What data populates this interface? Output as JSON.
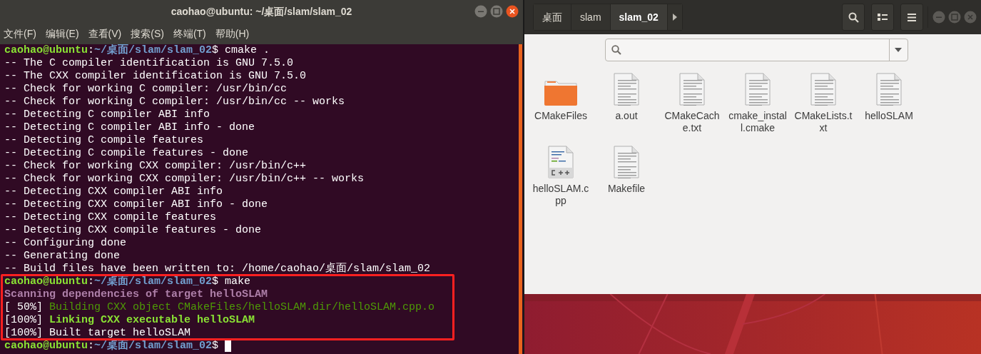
{
  "terminal": {
    "title": "caohao@ubuntu: ~/桌面/slam/slam_02",
    "menu": [
      "文件(F)",
      "编辑(E)",
      "查看(V)",
      "搜索(S)",
      "终端(T)",
      "帮助(H)"
    ],
    "lines": [
      {
        "segments": [
          {
            "text": "caohao@ubuntu",
            "kind": "user"
          },
          {
            "text": ":",
            "kind": "plain"
          },
          {
            "text": "~/桌面/slam/slam_02",
            "kind": "path"
          },
          {
            "text": "$ cmake .",
            "kind": "plain"
          }
        ]
      },
      {
        "segments": [
          {
            "text": "-- The C compiler identification is GNU 7.5.0",
            "kind": "plain"
          }
        ]
      },
      {
        "segments": [
          {
            "text": "-- The CXX compiler identification is GNU 7.5.0",
            "kind": "plain"
          }
        ]
      },
      {
        "segments": [
          {
            "text": "-- Check for working C compiler: /usr/bin/cc",
            "kind": "plain"
          }
        ]
      },
      {
        "segments": [
          {
            "text": "-- Check for working C compiler: /usr/bin/cc -- works",
            "kind": "plain"
          }
        ]
      },
      {
        "segments": [
          {
            "text": "-- Detecting C compiler ABI info",
            "kind": "plain"
          }
        ]
      },
      {
        "segments": [
          {
            "text": "-- Detecting C compiler ABI info - done",
            "kind": "plain"
          }
        ]
      },
      {
        "segments": [
          {
            "text": "-- Detecting C compile features",
            "kind": "plain"
          }
        ]
      },
      {
        "segments": [
          {
            "text": "-- Detecting C compile features - done",
            "kind": "plain"
          }
        ]
      },
      {
        "segments": [
          {
            "text": "-- Check for working CXX compiler: /usr/bin/c++",
            "kind": "plain"
          }
        ]
      },
      {
        "segments": [
          {
            "text": "-- Check for working CXX compiler: /usr/bin/c++ -- works",
            "kind": "plain"
          }
        ]
      },
      {
        "segments": [
          {
            "text": "-- Detecting CXX compiler ABI info",
            "kind": "plain"
          }
        ]
      },
      {
        "segments": [
          {
            "text": "-- Detecting CXX compiler ABI info - done",
            "kind": "plain"
          }
        ]
      },
      {
        "segments": [
          {
            "text": "-- Detecting CXX compile features",
            "kind": "plain"
          }
        ]
      },
      {
        "segments": [
          {
            "text": "-- Detecting CXX compile features - done",
            "kind": "plain"
          }
        ]
      },
      {
        "segments": [
          {
            "text": "-- Configuring done",
            "kind": "plain"
          }
        ]
      },
      {
        "segments": [
          {
            "text": "-- Generating done",
            "kind": "plain"
          }
        ]
      },
      {
        "segments": [
          {
            "text": "-- Build files have been written to: /home/caohao/桌面/slam/slam_02",
            "kind": "plain"
          }
        ]
      },
      {
        "segments": [
          {
            "text": "caohao@ubuntu",
            "kind": "user"
          },
          {
            "text": ":",
            "kind": "plain"
          },
          {
            "text": "~/桌面/slam/slam_02",
            "kind": "path"
          },
          {
            "text": "$ make",
            "kind": "plain"
          }
        ]
      },
      {
        "segments": [
          {
            "text": "Scanning dependencies of target helloSLAM",
            "kind": "scan"
          }
        ]
      },
      {
        "segments": [
          {
            "text": "[ 50%] ",
            "kind": "plain"
          },
          {
            "text": "Building CXX object CMakeFiles/helloSLAM.dir/helloSLAM.cpp.o",
            "kind": "build"
          }
        ]
      },
      {
        "segments": [
          {
            "text": "[100%] ",
            "kind": "plain"
          },
          {
            "text": "Linking CXX executable helloSLAM",
            "kind": "link"
          }
        ]
      },
      {
        "segments": [
          {
            "text": "[100%] Built target helloSLAM",
            "kind": "plain"
          }
        ]
      },
      {
        "segments": [
          {
            "text": "caohao@ubuntu",
            "kind": "user"
          },
          {
            "text": ":",
            "kind": "plain"
          },
          {
            "text": "~/桌面/slam/slam_02",
            "kind": "path"
          },
          {
            "text": "$ ",
            "kind": "plain"
          }
        ],
        "cursor": true
      }
    ]
  },
  "files": {
    "path": [
      {
        "label": "桌面",
        "selected": false
      },
      {
        "label": "slam",
        "selected": false
      },
      {
        "label": "slam_02",
        "selected": true
      }
    ],
    "items": [
      {
        "name": "CMakeFiles",
        "kind": "folder"
      },
      {
        "name": "a.out",
        "kind": "text"
      },
      {
        "name": "CMakeCache.txt",
        "kind": "text"
      },
      {
        "name": "cmake_install.cmake",
        "kind": "text"
      },
      {
        "name": "CMakeLists.txt",
        "kind": "text"
      },
      {
        "name": "helloSLAM",
        "kind": "text"
      },
      {
        "name": "helloSLAM.cpp",
        "kind": "cpp"
      },
      {
        "name": "Makefile",
        "kind": "text"
      }
    ]
  }
}
